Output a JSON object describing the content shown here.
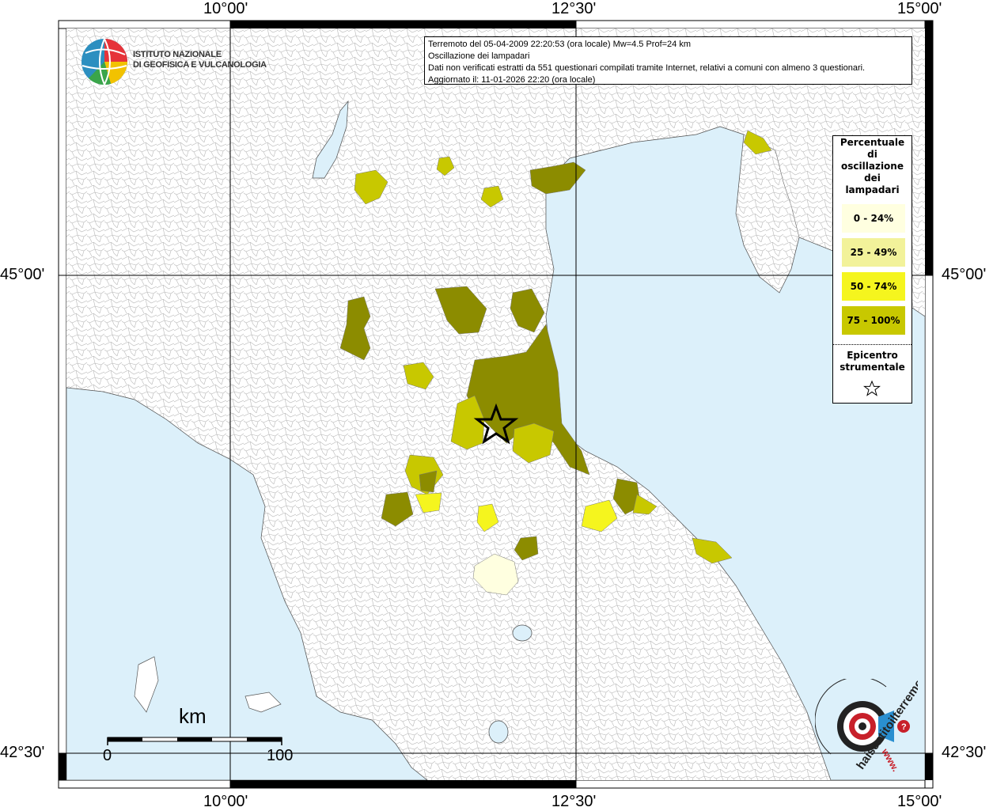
{
  "map": {
    "longitude_labels": [
      "10°00'",
      "12°30'",
      "15°00'"
    ],
    "latitude_labels": [
      "45°00'",
      "42°30'"
    ]
  },
  "info": {
    "line1": "Terremoto del 05-04-2009 22:20:53 (ora locale) Mw=4.5 Prof=24 km",
    "line2": "Oscillazione dei lampadari",
    "line3": "Dati non verificati estratti da 551 questionari compilati tramite Internet, relativi a comuni con almeno 3 questionari.",
    "line4": "Aggiornato il: 11-01-2026 22:20 (ora locale)"
  },
  "institute": {
    "line1": "ISTITUTO NAZIONALE",
    "line2": "DI GEOFISICA E VULCANOLOGIA"
  },
  "legend": {
    "title_lines": [
      "Percentuale",
      "di",
      "oscillazione",
      "dei",
      "lampadari"
    ],
    "classes": [
      {
        "label": "0 - 24%",
        "color": "#ffffe0"
      },
      {
        "label": "25 - 49%",
        "color": "#f2f29a"
      },
      {
        "label": "50 - 74%",
        "color": "#f5f51e"
      },
      {
        "label": "75 - 100%",
        "color": "#c8c800"
      }
    ],
    "epicenter_lines": [
      "Epicentro",
      "strumentale"
    ]
  },
  "scale": {
    "unit": "km",
    "start": "0",
    "end": "100"
  },
  "watermark": {
    "text": "haisentitoilterremoto.it",
    "url_text": "www."
  },
  "colors": {
    "sea": "#dcf0fa",
    "class_dark": "#8c8c00"
  }
}
